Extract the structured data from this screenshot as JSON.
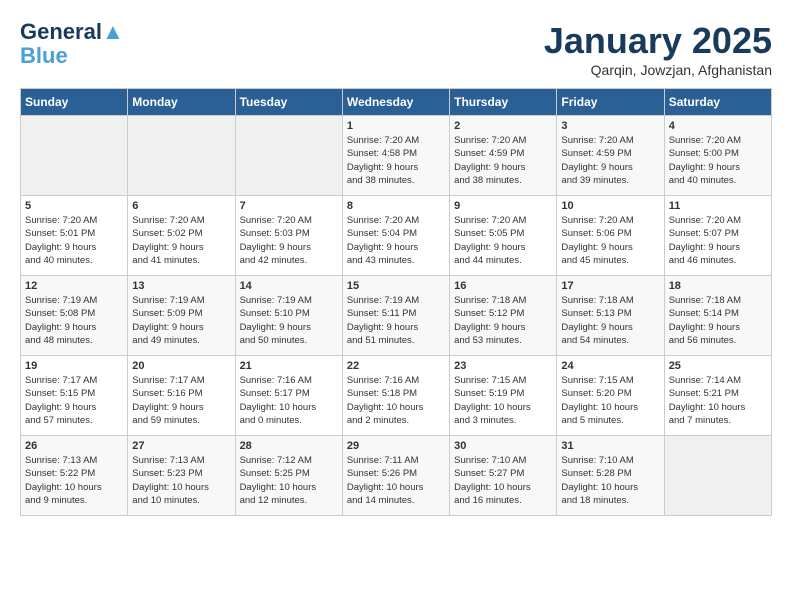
{
  "header": {
    "logo_line1": "General",
    "logo_line2": "Blue",
    "title": "January 2025",
    "subtitle": "Qarqin, Jowzjan, Afghanistan"
  },
  "days_of_week": [
    "Sunday",
    "Monday",
    "Tuesday",
    "Wednesday",
    "Thursday",
    "Friday",
    "Saturday"
  ],
  "weeks": [
    [
      {
        "day": "",
        "info": ""
      },
      {
        "day": "",
        "info": ""
      },
      {
        "day": "",
        "info": ""
      },
      {
        "day": "1",
        "info": "Sunrise: 7:20 AM\nSunset: 4:58 PM\nDaylight: 9 hours\nand 38 minutes."
      },
      {
        "day": "2",
        "info": "Sunrise: 7:20 AM\nSunset: 4:59 PM\nDaylight: 9 hours\nand 38 minutes."
      },
      {
        "day": "3",
        "info": "Sunrise: 7:20 AM\nSunset: 4:59 PM\nDaylight: 9 hours\nand 39 minutes."
      },
      {
        "day": "4",
        "info": "Sunrise: 7:20 AM\nSunset: 5:00 PM\nDaylight: 9 hours\nand 40 minutes."
      }
    ],
    [
      {
        "day": "5",
        "info": "Sunrise: 7:20 AM\nSunset: 5:01 PM\nDaylight: 9 hours\nand 40 minutes."
      },
      {
        "day": "6",
        "info": "Sunrise: 7:20 AM\nSunset: 5:02 PM\nDaylight: 9 hours\nand 41 minutes."
      },
      {
        "day": "7",
        "info": "Sunrise: 7:20 AM\nSunset: 5:03 PM\nDaylight: 9 hours\nand 42 minutes."
      },
      {
        "day": "8",
        "info": "Sunrise: 7:20 AM\nSunset: 5:04 PM\nDaylight: 9 hours\nand 43 minutes."
      },
      {
        "day": "9",
        "info": "Sunrise: 7:20 AM\nSunset: 5:05 PM\nDaylight: 9 hours\nand 44 minutes."
      },
      {
        "day": "10",
        "info": "Sunrise: 7:20 AM\nSunset: 5:06 PM\nDaylight: 9 hours\nand 45 minutes."
      },
      {
        "day": "11",
        "info": "Sunrise: 7:20 AM\nSunset: 5:07 PM\nDaylight: 9 hours\nand 46 minutes."
      }
    ],
    [
      {
        "day": "12",
        "info": "Sunrise: 7:19 AM\nSunset: 5:08 PM\nDaylight: 9 hours\nand 48 minutes."
      },
      {
        "day": "13",
        "info": "Sunrise: 7:19 AM\nSunset: 5:09 PM\nDaylight: 9 hours\nand 49 minutes."
      },
      {
        "day": "14",
        "info": "Sunrise: 7:19 AM\nSunset: 5:10 PM\nDaylight: 9 hours\nand 50 minutes."
      },
      {
        "day": "15",
        "info": "Sunrise: 7:19 AM\nSunset: 5:11 PM\nDaylight: 9 hours\nand 51 minutes."
      },
      {
        "day": "16",
        "info": "Sunrise: 7:18 AM\nSunset: 5:12 PM\nDaylight: 9 hours\nand 53 minutes."
      },
      {
        "day": "17",
        "info": "Sunrise: 7:18 AM\nSunset: 5:13 PM\nDaylight: 9 hours\nand 54 minutes."
      },
      {
        "day": "18",
        "info": "Sunrise: 7:18 AM\nSunset: 5:14 PM\nDaylight: 9 hours\nand 56 minutes."
      }
    ],
    [
      {
        "day": "19",
        "info": "Sunrise: 7:17 AM\nSunset: 5:15 PM\nDaylight: 9 hours\nand 57 minutes."
      },
      {
        "day": "20",
        "info": "Sunrise: 7:17 AM\nSunset: 5:16 PM\nDaylight: 9 hours\nand 59 minutes."
      },
      {
        "day": "21",
        "info": "Sunrise: 7:16 AM\nSunset: 5:17 PM\nDaylight: 10 hours\nand 0 minutes."
      },
      {
        "day": "22",
        "info": "Sunrise: 7:16 AM\nSunset: 5:18 PM\nDaylight: 10 hours\nand 2 minutes."
      },
      {
        "day": "23",
        "info": "Sunrise: 7:15 AM\nSunset: 5:19 PM\nDaylight: 10 hours\nand 3 minutes."
      },
      {
        "day": "24",
        "info": "Sunrise: 7:15 AM\nSunset: 5:20 PM\nDaylight: 10 hours\nand 5 minutes."
      },
      {
        "day": "25",
        "info": "Sunrise: 7:14 AM\nSunset: 5:21 PM\nDaylight: 10 hours\nand 7 minutes."
      }
    ],
    [
      {
        "day": "26",
        "info": "Sunrise: 7:13 AM\nSunset: 5:22 PM\nDaylight: 10 hours\nand 9 minutes."
      },
      {
        "day": "27",
        "info": "Sunrise: 7:13 AM\nSunset: 5:23 PM\nDaylight: 10 hours\nand 10 minutes."
      },
      {
        "day": "28",
        "info": "Sunrise: 7:12 AM\nSunset: 5:25 PM\nDaylight: 10 hours\nand 12 minutes."
      },
      {
        "day": "29",
        "info": "Sunrise: 7:11 AM\nSunset: 5:26 PM\nDaylight: 10 hours\nand 14 minutes."
      },
      {
        "day": "30",
        "info": "Sunrise: 7:10 AM\nSunset: 5:27 PM\nDaylight: 10 hours\nand 16 minutes."
      },
      {
        "day": "31",
        "info": "Sunrise: 7:10 AM\nSunset: 5:28 PM\nDaylight: 10 hours\nand 18 minutes."
      },
      {
        "day": "",
        "info": ""
      }
    ]
  ]
}
